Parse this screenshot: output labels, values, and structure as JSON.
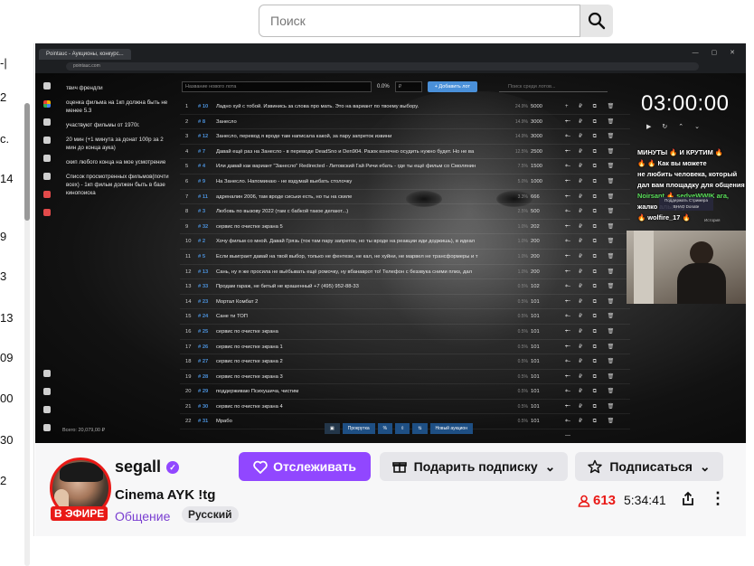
{
  "search": {
    "placeholder": "Поиск"
  },
  "left_strip": {
    "items": [
      "-|",
      "2",
      "с.",
      "14",
      "9",
      "3",
      "13",
      "09",
      "00",
      "30",
      "2"
    ]
  },
  "stream_view": {
    "browser": {
      "tab_label": "Pointauc - Аукционы, конкурс...",
      "url": "pointauc.com"
    },
    "rules": [
      "твич френдли",
      "оценка фильма на 1кп должна быть не менее 5.3",
      "участвуют фильмы от 1970г.",
      "20 мин (+1 минута за донат 100р за 2 мин до конца аука)",
      "скип любого конца на мое усмотрение",
      "Список просмотренных фильмов(почти всех) - 1кп фильм должен быть в базе кинопоиска"
    ],
    "total_label": "Всего: 20,079,00 ₽",
    "controls": {
      "lot_placeholder": "Название нового лота",
      "percent": "0.0%",
      "amount_placeholder": "₽",
      "add_label": "+ Добавить лот",
      "search_lots_placeholder": "Поиск среди лотов..."
    },
    "lots": [
      {
        "n": "1",
        "id": "# 10",
        "name": "Ладно хуй с тобой. Извинись за слова про мать. Это на вариант по твоему выбору.",
        "pct": "24.9%",
        "amount": "5000"
      },
      {
        "n": "2",
        "id": "# 8",
        "name": "Занесло",
        "pct": "14.9%",
        "amount": "3000"
      },
      {
        "n": "3",
        "id": "# 12",
        "name": "Занесло, перевод я вроде там написала какой, за пару запреток извини",
        "pct": "14.9%",
        "amount": "3000"
      },
      {
        "n": "4",
        "id": "# 7",
        "name": "Давай ещё раз на Занесло - в переводе DeadSno и Den904. Разок конечно осудить нужно будет. Но не ва",
        "pct": "12.5%",
        "amount": "2500"
      },
      {
        "n": "5",
        "id": "# 4",
        "name": "Или давай как вариант \"Занесло\" Redirected - Литовский Гай Ричи ебать - где ты ещё фильм со Смолянин",
        "pct": "7.5%",
        "amount": "1500"
      },
      {
        "n": "6",
        "id": "# 9",
        "name": "На Занесло. Напоминаю - не вздумай вьебать столочку",
        "pct": "5.0%",
        "amount": "1000"
      },
      {
        "n": "7",
        "id": "# 11",
        "name": "адреналин 2006, там вроде сиськи есть, но ты на скиле",
        "pct": "3.3%",
        "amount": "666"
      },
      {
        "n": "8",
        "id": "# 3",
        "name": "Любовь по вызову 2022 (там с бабкой такое делают...)",
        "pct": "2.5%",
        "amount": "500"
      },
      {
        "n": "9",
        "id": "# 32",
        "name": "сервис по очистке экрана 5",
        "pct": "1.0%",
        "amount": "202"
      },
      {
        "n": "10",
        "id": "# 2",
        "name": "Хочу фильм со мной. Давай Грязь (ток там пару запреток, но ты вроде на реакции иди доджишь), в идеал",
        "pct": "1.0%",
        "amount": "200"
      },
      {
        "n": "11",
        "id": "# 5",
        "name": "Если выиграет давай на твой выбор, только не фентези, не кал, не хуйни, не марвел не трансформеры и т",
        "pct": "1.0%",
        "amount": "200"
      },
      {
        "n": "12",
        "id": "# 13",
        "name": "Сань, ну я же просила не вьёбывать ещё ромочку, ну вбанаврот то! Телефон с беззвука сними плиз, дал",
        "pct": "1.0%",
        "amount": "200"
      },
      {
        "n": "13",
        "id": "# 33",
        "name": "Продам гараж, не битый не крашенный +7 (495) 952-88-33",
        "pct": "0.5%",
        "amount": "102"
      },
      {
        "n": "14",
        "id": "# 23",
        "name": "Мортал Комбат 2",
        "pct": "0.5%",
        "amount": "101"
      },
      {
        "n": "15",
        "id": "# 24",
        "name": "Сане ти ТОП",
        "pct": "0.5%",
        "amount": "101"
      },
      {
        "n": "16",
        "id": "# 25",
        "name": "сервис по очистке экрана",
        "pct": "0.5%",
        "amount": "101"
      },
      {
        "n": "17",
        "id": "# 26",
        "name": "сервис по очистке экрана 1",
        "pct": "0.5%",
        "amount": "101"
      },
      {
        "n": "18",
        "id": "# 27",
        "name": "сервис по очистке экрана 2",
        "pct": "0.5%",
        "amount": "101"
      },
      {
        "n": "19",
        "id": "# 28",
        "name": "сервис по очистке экрана 3",
        "pct": "0.5%",
        "amount": "101"
      },
      {
        "n": "20",
        "id": "# 29",
        "name": "поддерживаю Психушича, чистим",
        "pct": "0.5%",
        "amount": "101"
      },
      {
        "n": "21",
        "id": "# 30",
        "name": "сервис по очистке экрана 4",
        "pct": "0.5%",
        "amount": "101"
      },
      {
        "n": "22",
        "id": "# 31",
        "name": "Мрабо",
        "pct": "0.5%",
        "amount": "101"
      }
    ],
    "timer": "03:00:00",
    "overlay_chat": [
      "МИНУТЫ 🔥 И КРУТИМ 🔥",
      "🔥 🔥 Как вы можете",
      "не любить человека, который",
      "дал вам площадку для общения",
      "Noirsant 🔥 sedyeWWIK ага,",
      "жалко альгуху",
      "🔥 wolfire_17 🔥"
    ],
    "donate_label": "Поддержать Стримера ВНАО Donate",
    "history_label": "История",
    "bottom_toolbar": [
      "Прокрутка",
      "Новый аукцион"
    ]
  },
  "channel": {
    "streamer": "segall",
    "live_badge": "В ЭФИРЕ",
    "stream_title": "Cinema AYK !tg",
    "category": "Общение",
    "tag": "Русский",
    "follow_label": "Отслеживать",
    "gift_label": "Подарить подписку",
    "subscribe_label": "Подписаться",
    "viewers": "613",
    "uptime": "5:34:41",
    "colors": {
      "accent": "#9147ff",
      "live": "#e91916"
    }
  }
}
